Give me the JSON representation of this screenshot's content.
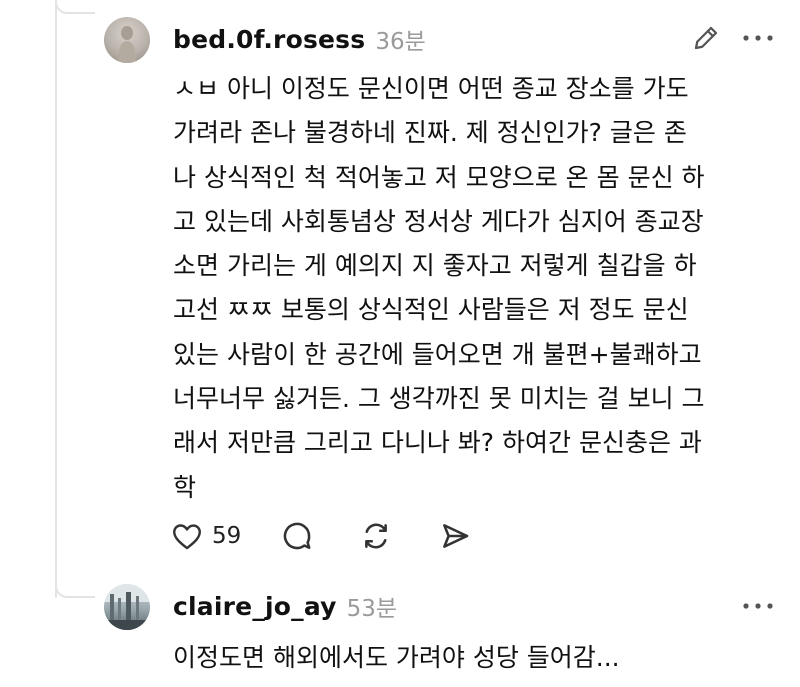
{
  "comments": [
    {
      "username": "bed.0f.rosess",
      "time": "36분",
      "text": "ㅅㅂ 아니 이정도 문신이면 어떤 종교 장소를 가도\n가려라 존나 불경하네 진짜. 제 정신인가? 글은 존\n나 상식적인 척 적어놓고 저 모양으로 온 몸 문신 하\n고 있는데 사회통념상 정서상 게다가 심지어 종교장\n소면 가리는 게 예의지 지 좋자고 저렇게 칠갑을 하\n고선 ㅉㅉ 보통의 상식적인 사람들은 저 정도 문신\n있는 사람이 한 공간에 들어오면 개 불편+불쾌하고\n너무너무 싫거든. 그 생각까진 못 미치는 걸 보니 그\n래서 저만큼 그리고 다니나 봐? 하여간 문신충은 과\n학",
      "likes": "59",
      "icons": {
        "edit": "pencil-icon",
        "more": "more-horizontal-icon",
        "like": "heart-icon",
        "reply": "comment-bubble-icon",
        "repost": "repost-icon",
        "share": "send-icon"
      }
    },
    {
      "username": "claire_jo_ay",
      "time": "53분",
      "text": "이정도면 해외에서도 가려야 성당 들어감...",
      "icons": {
        "more": "more-horizontal-icon"
      }
    }
  ],
  "colors": {
    "text": "#111111",
    "muted": "#9a9a9a",
    "thread_line": "#e3e3e3",
    "icon": "#333333"
  }
}
